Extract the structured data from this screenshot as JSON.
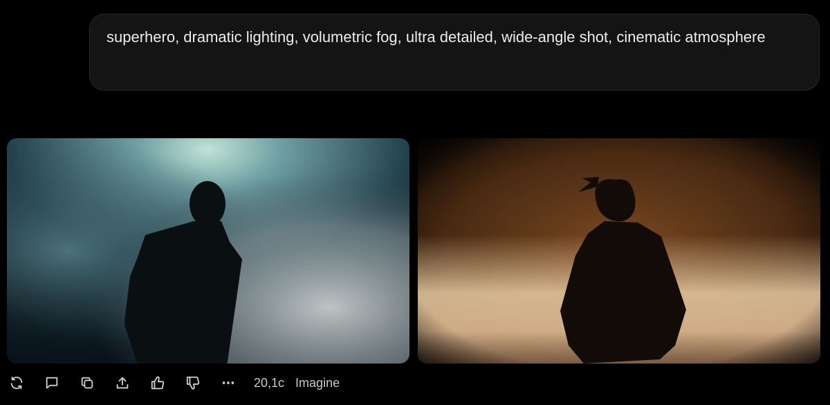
{
  "prompt": {
    "text": "superhero, dramatic lighting, volumetric fog, ultra detailed, wide-angle shot, cinematic atmosphere"
  },
  "images": [
    {
      "name": "generated-image-1",
      "icon": "silhouette-teal-fog",
      "colors": {
        "glow": "#7fb6b2",
        "fog": "#9aa6a6",
        "shadow": "#0a1216"
      }
    },
    {
      "name": "generated-image-2",
      "icon": "silhouette-amber-fog",
      "colors": {
        "glow": "#e6c39a",
        "fog": "#d8b48e",
        "shadow": "#1a0f08"
      }
    }
  ],
  "toolbar": {
    "icons": [
      "regenerate-icon",
      "comment-icon",
      "copy-icon",
      "share-icon",
      "thumbs-up-icon",
      "thumbs-down-icon",
      "more-icon"
    ],
    "count_label": "20,1c",
    "model_label": "Imagine"
  },
  "colors": {
    "background": "#000000",
    "bubble": "#141414",
    "text": "#ececec",
    "icon": "#cfcfcf"
  }
}
